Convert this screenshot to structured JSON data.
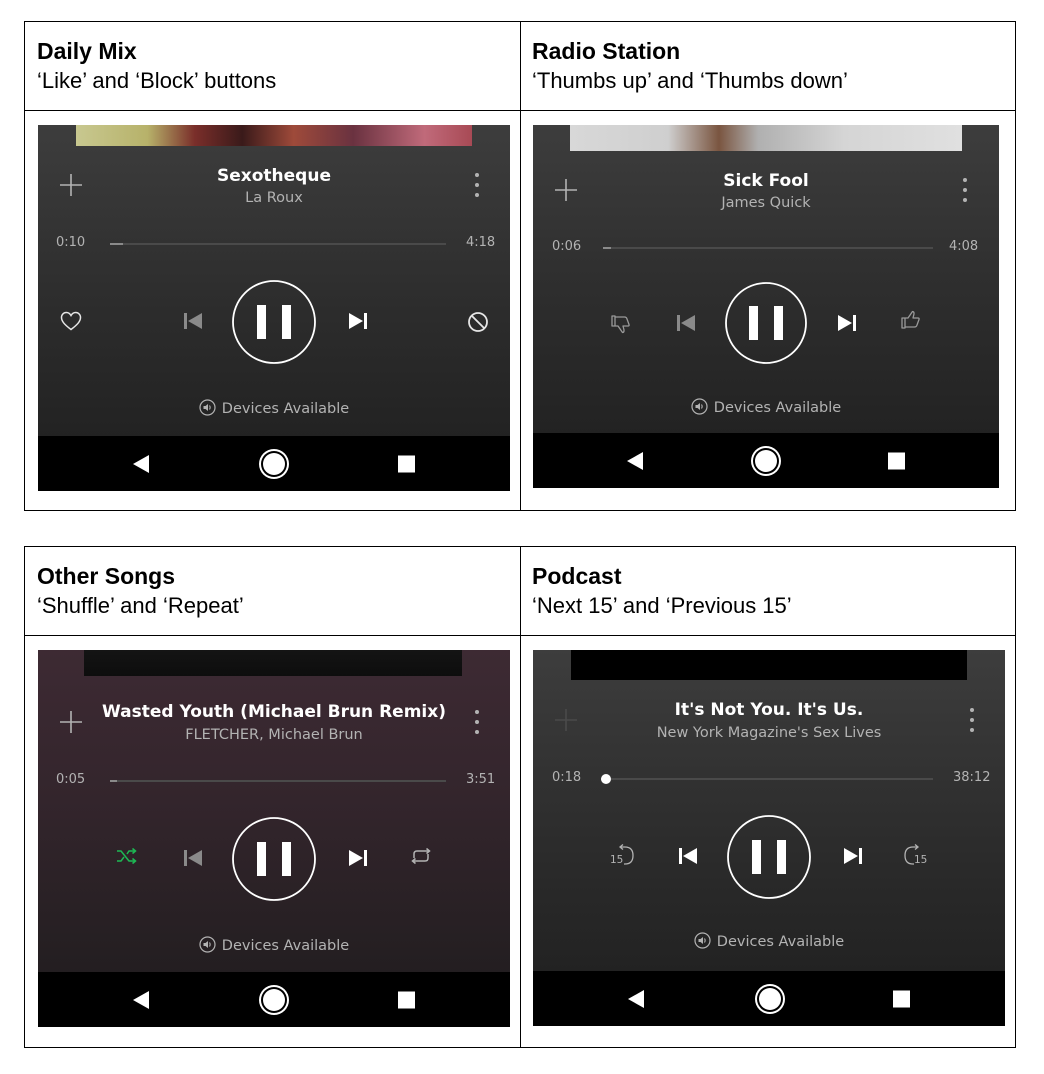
{
  "panels": [
    {
      "heading": "Daily Mix",
      "subheading": "‘Like’ and ‘Block’ buttons",
      "track": "Sexotheque",
      "artist": "La Roux",
      "elapsed": "0:10",
      "duration": "4:18",
      "progress": 0.04,
      "left_control": "heart-icon",
      "right_control": "block-icon",
      "devices": "Devices Available"
    },
    {
      "heading": "Radio Station",
      "subheading": "‘Thumbs up’ and ‘Thumbs down’",
      "track": "Sick Fool",
      "artist": "James Quick",
      "elapsed": "0:06",
      "duration": "4:08",
      "progress": 0.02,
      "left_control": "thumbs-down-icon",
      "right_control": "thumbs-up-icon",
      "devices": "Devices Available"
    },
    {
      "heading": "Other Songs",
      "subheading": "‘Shuffle’ and ‘Repeat’",
      "track": "Wasted Youth (Michael Brun Remix)",
      "artist": "FLETCHER, Michael Brun",
      "elapsed": "0:05",
      "duration": "3:51",
      "progress": 0.02,
      "left_control": "shuffle-icon",
      "right_control": "repeat-icon",
      "shuffle_active_color": "#1db954",
      "devices": "Devices Available"
    },
    {
      "heading": "Podcast",
      "subheading": "‘Next 15’ and ‘Previous 15’",
      "track": "It's Not You. It's Us.",
      "artist": "New York Magazine's Sex Lives",
      "elapsed": "0:18",
      "duration": "38:12",
      "progress": 0.01,
      "left_control": "rewind-15-icon",
      "right_control": "forward-15-icon",
      "skip_label": "15",
      "devices": "Devices Available"
    }
  ],
  "colors": {
    "player_bg": "#2e2e2e",
    "player_bg_purple": "#33252c",
    "text_primary": "#ffffff",
    "text_secondary": "#b3b3b3",
    "accent_green": "#1db954"
  }
}
